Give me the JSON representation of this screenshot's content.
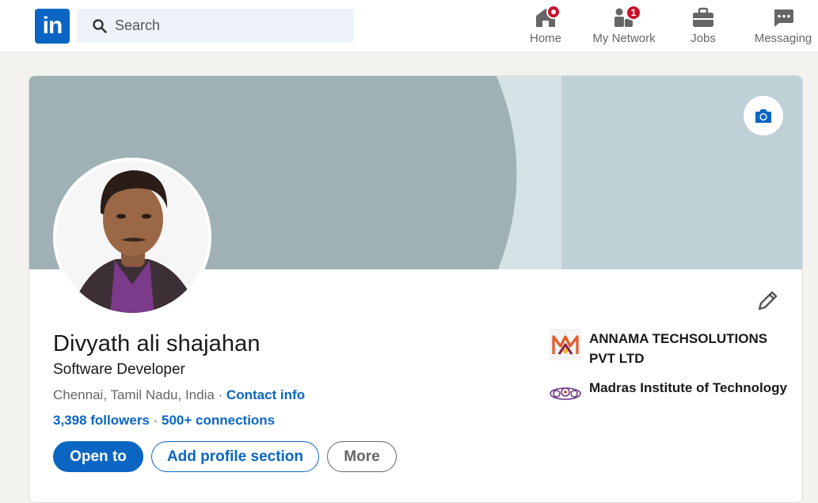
{
  "nav": {
    "logo_text": "in",
    "search_placeholder": "Search",
    "items": [
      {
        "label": "Home",
        "icon": "home-icon",
        "badge": ""
      },
      {
        "label": "My Network",
        "icon": "people-icon",
        "badge": "1"
      },
      {
        "label": "Jobs",
        "icon": "briefcase-icon",
        "badge": ""
      },
      {
        "label": "Messaging",
        "icon": "chat-icon",
        "badge": ""
      }
    ]
  },
  "profile": {
    "name": "Divyath ali shajahan",
    "headline": "Software Developer",
    "location": "Chennai, Tamil Nadu, India",
    "location_separator": " · ",
    "contact_info": "Contact info",
    "followers": "3,398 followers",
    "stats_separator": " · ",
    "connections": "500+ connections",
    "buttons": {
      "open_to": "Open to",
      "add_section": "Add profile section",
      "more": "More"
    },
    "organizations": [
      {
        "name": "ANNAMA TECHSOLUTIONS PVT LTD",
        "icon": "company-logo"
      },
      {
        "name": "Madras Institute of Technology",
        "icon": "school-logo"
      }
    ]
  },
  "colors": {
    "brand": "#0a66c2",
    "badge": "#cb112d",
    "banner_dark": "#a0b1b5",
    "banner_light": "#d6e3e6",
    "banner_right": "#bdd1d6"
  }
}
